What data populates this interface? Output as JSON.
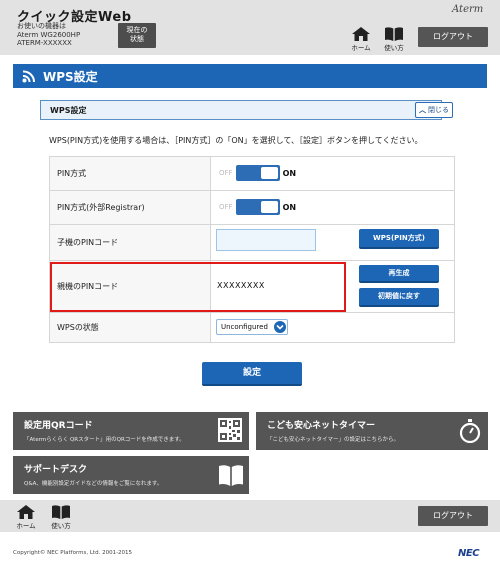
{
  "header": {
    "app_title": "クイック設定Web",
    "device_info": [
      "お使いの機器は",
      "Aterm WG2600HP",
      "ATERM-XXXXXX"
    ],
    "status_button": [
      "現在の",
      "状態"
    ],
    "brand": "Aterm",
    "nav": [
      {
        "label": "ホーム",
        "icon": "home-icon"
      },
      {
        "label": "使い方",
        "icon": "book-icon"
      }
    ],
    "logout_label": "ログアウト"
  },
  "page": {
    "title": "WPS設定",
    "title_icon": "wifi-icon",
    "accent_color": "#1d66b5"
  },
  "panel": {
    "title": "WPS設定",
    "collapse_label": "閉じる"
  },
  "instruction": "WPS(PIN方式)を使用する場合は、［PIN方式］の「ON」を選択して、［設定］ボタンを押してください。",
  "settings": {
    "rows": [
      {
        "label": "PIN方式",
        "toggle_off": "OFF",
        "toggle_on": "ON",
        "state": "ON"
      },
      {
        "label": "PIN方式(外部Registrar)",
        "toggle_off": "OFF",
        "toggle_on": "ON",
        "state": "ON"
      },
      {
        "label": "子機のPINコード",
        "input_value": "",
        "button": "WPS(PIN方式)"
      },
      {
        "label": "親機のPINコード",
        "value": "XXXXXXXX",
        "buttons": [
          "再生成",
          "初期値に戻す"
        ]
      },
      {
        "label": "WPSの状態",
        "select_value": "Unconfigured"
      }
    ]
  },
  "submit_label": "設定",
  "tiles": [
    {
      "title": "設定用QRコード",
      "desc": "「Atermらくらく QRスタート」用のQRコードを作成できます。",
      "icon": "qr-code-icon"
    },
    {
      "title": "こども安心ネットタイマー",
      "desc": "「こども安心ネットタイマー」の設定はこちらから。",
      "icon": "timer-icon"
    },
    {
      "title": "サポートデスク",
      "desc": "Q&A、機能別設定ガイドなどの情報をご覧になれます。",
      "icon": "book-icon"
    }
  ],
  "footer": {
    "nav": [
      {
        "label": "ホーム",
        "icon": "home-icon"
      },
      {
        "label": "使い方",
        "icon": "book-icon"
      }
    ],
    "logout_label": "ログアウト",
    "copyright": "Copyright© NEC Platforms, Ltd. 2001-2015",
    "logo": "NEC"
  }
}
